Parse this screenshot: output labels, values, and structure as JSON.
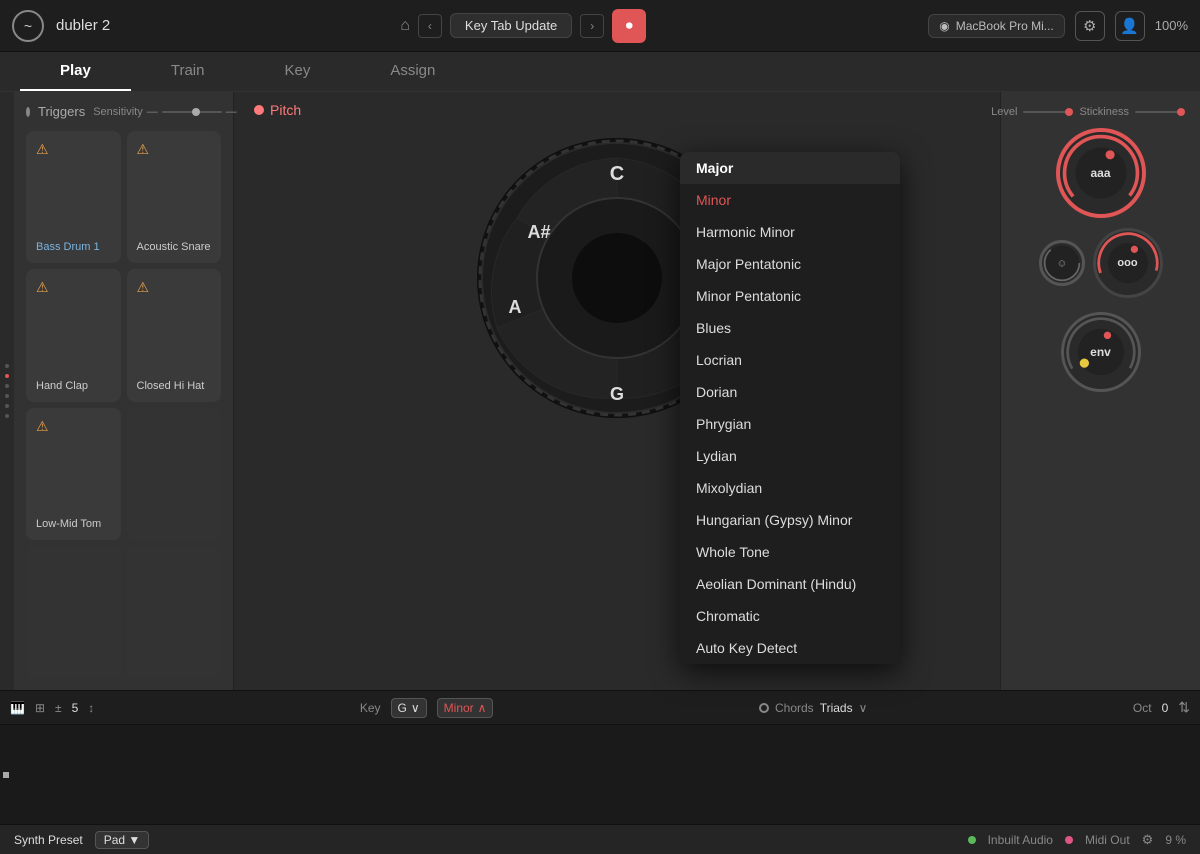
{
  "app": {
    "title": "dubler 2",
    "logo": "~"
  },
  "topbar": {
    "home_icon": "⌂",
    "project_name": "Key Tab Update",
    "nav_back": "‹",
    "nav_forward": "›",
    "record_icon": "⏺",
    "audio_source": "MacBook Pro Mi...",
    "settings_icon": "⚙",
    "profile_icon": "👤",
    "zoom": "100%"
  },
  "tabs": [
    {
      "id": "play",
      "label": "Play",
      "active": true
    },
    {
      "id": "train",
      "label": "Train",
      "active": false
    },
    {
      "id": "key",
      "label": "Key",
      "active": false
    },
    {
      "id": "assign",
      "label": "Assign",
      "active": false
    }
  ],
  "left_panel": {
    "triggers_label": "Triggers",
    "sensitivity_label": "Sensitivity",
    "pads": [
      {
        "id": "bass-drum",
        "name": "Bass Drum 1",
        "color": "blue",
        "has_warn": true
      },
      {
        "id": "acoustic-snare",
        "name": "Acoustic Snare",
        "color": "white",
        "has_warn": true
      },
      {
        "id": "hand-clap",
        "name": "Hand Clap",
        "color": "white",
        "has_warn": true
      },
      {
        "id": "closed-hi-hat",
        "name": "Closed Hi Hat",
        "color": "white",
        "has_warn": true
      },
      {
        "id": "low-mid-tom",
        "name": "Low-Mid Tom",
        "color": "white",
        "has_warn": true
      },
      {
        "id": "empty1",
        "name": "",
        "color": "none",
        "has_warn": false
      },
      {
        "id": "empty2",
        "name": "",
        "color": "none",
        "has_warn": false
      },
      {
        "id": "empty3",
        "name": "",
        "color": "none",
        "has_warn": false
      }
    ]
  },
  "center_panel": {
    "pitch_label": "Pitch",
    "notes": [
      "C",
      "A#",
      "A",
      "G"
    ]
  },
  "right_panel": {
    "stickiness_label": "Stickiness",
    "knob_aaa": "aaa",
    "knob_ooo": "ooo",
    "knob_env": "env",
    "level_label": "Level"
  },
  "dropdown": {
    "items": [
      {
        "id": "major",
        "label": "Major",
        "selected": false
      },
      {
        "id": "minor",
        "label": "Minor",
        "selected": true
      },
      {
        "id": "harmonic-minor",
        "label": "Harmonic Minor",
        "selected": false
      },
      {
        "id": "major-pentatonic",
        "label": "Major Pentatonic",
        "selected": false
      },
      {
        "id": "minor-pentatonic",
        "label": "Minor Pentatonic",
        "selected": false
      },
      {
        "id": "blues",
        "label": "Blues",
        "selected": false
      },
      {
        "id": "locrian",
        "label": "Locrian",
        "selected": false
      },
      {
        "id": "dorian",
        "label": "Dorian",
        "selected": false
      },
      {
        "id": "phrygian",
        "label": "Phrygian",
        "selected": false
      },
      {
        "id": "lydian",
        "label": "Lydian",
        "selected": false
      },
      {
        "id": "mixolydian",
        "label": "Mixolydian",
        "selected": false
      },
      {
        "id": "hungarian",
        "label": "Hungarian (Gypsy) Minor",
        "selected": false
      },
      {
        "id": "whole-tone",
        "label": "Whole Tone",
        "selected": false
      },
      {
        "id": "aeolian",
        "label": "Aeolian Dominant (Hindu)",
        "selected": false
      },
      {
        "id": "chromatic",
        "label": "Chromatic",
        "selected": false
      },
      {
        "id": "auto-key-detect",
        "label": "Auto Key Detect",
        "selected": false
      }
    ]
  },
  "bottom_bar": {
    "steps": "5",
    "key_label": "Key",
    "key_value": "G",
    "scale_value": "Minor",
    "chords_label": "Chords",
    "chords_type": "Triads",
    "oct_label": "Oct",
    "oct_value": "0"
  },
  "synth_bar": {
    "preset_label": "Synth Preset",
    "preset_value": "Pad",
    "inbuilt_label": "Inbuilt Audio",
    "midi_label": "Midi Out",
    "gear_icon": "⚙",
    "percent": "9 %"
  }
}
